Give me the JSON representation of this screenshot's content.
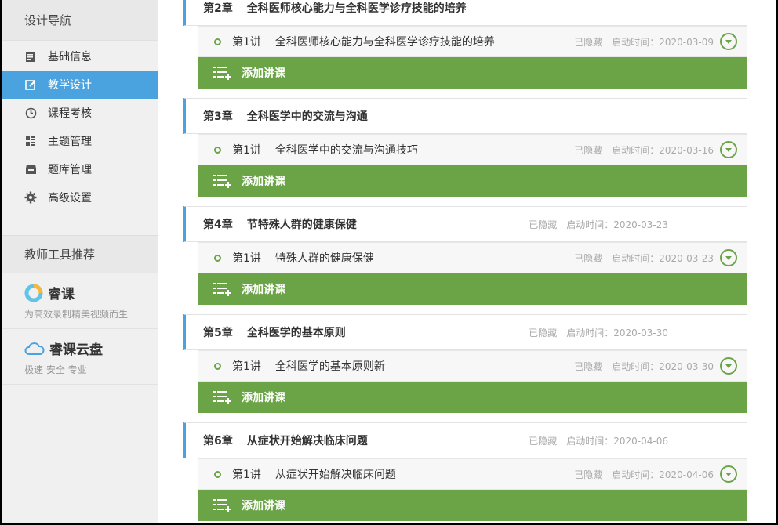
{
  "sidebar": {
    "title": "设计导航",
    "items": [
      {
        "label": "基础信息",
        "icon": "document-icon"
      },
      {
        "label": "教学设计",
        "icon": "edit-icon"
      },
      {
        "label": "课程考核",
        "icon": "clock-icon"
      },
      {
        "label": "主题管理",
        "icon": "grid-icon"
      },
      {
        "label": "题库管理",
        "icon": "inbox-icon"
      },
      {
        "label": "高级设置",
        "icon": "gear-icon"
      }
    ],
    "tools_title": "教师工具推荐",
    "tools": [
      {
        "name": "睿课",
        "desc": "为高效录制精美视频而生"
      },
      {
        "name": "睿课云盘",
        "desc": "极速 安全 专业"
      }
    ]
  },
  "chapters": [
    {
      "num": "第2章",
      "name": "全科医师核心能力与全科医学诊疗技能的培养",
      "hidden": "",
      "start": "",
      "lecture": {
        "num": "第1讲",
        "name": "全科医师核心能力与全科医学诊疗技能的培养",
        "hidden": "已隐藏",
        "start": "启动时间：2020-03-09"
      },
      "add_label": "添加讲课"
    },
    {
      "num": "第3章",
      "name": "全科医学中的交流与沟通",
      "hidden": "",
      "start": "",
      "lecture": {
        "num": "第1讲",
        "name": "全科医学中的交流与沟通技巧",
        "hidden": "已隐藏",
        "start": "启动时间：2020-03-16"
      },
      "add_label": "添加讲课"
    },
    {
      "num": "第4章",
      "name": "节特殊人群的健康保健",
      "hidden": "已隐藏",
      "start": "启动时间：2020-03-23",
      "lecture": {
        "num": "第1讲",
        "name": "特殊人群的健康保健",
        "hidden": "已隐藏",
        "start": "启动时间：2020-03-23"
      },
      "add_label": "添加讲课"
    },
    {
      "num": "第5章",
      "name": "全科医学的基本原则",
      "hidden": "已隐藏",
      "start": "启动时间：2020-03-30",
      "lecture": {
        "num": "第1讲",
        "name": "全科医学的基本原则新",
        "hidden": "已隐藏",
        "start": "启动时间：2020-03-30"
      },
      "add_label": "添加讲课"
    },
    {
      "num": "第6章",
      "name": "从症状开始解决临床问题",
      "hidden": "已隐藏",
      "start": "启动时间：2020-04-06",
      "lecture": {
        "num": "第1讲",
        "name": "从症状开始解决临床问题",
        "hidden": "已隐藏",
        "start": "启动时间：2020-04-06"
      },
      "add_label": "添加讲课"
    }
  ],
  "colors": {
    "accent": "#4aa3df",
    "green": "#6ba347"
  }
}
